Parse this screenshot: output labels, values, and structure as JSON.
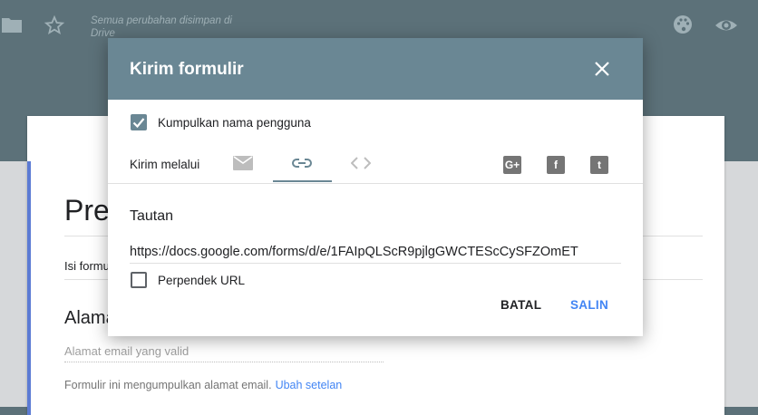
{
  "app": {
    "save_status": "Semua perubahan disimpan di Drive"
  },
  "form": {
    "title": "Pre",
    "description": "Isi formu",
    "question_title": "Alama",
    "question_placeholder": "Alamat email yang valid",
    "note": "Formulir ini mengumpulkan alamat email.",
    "note_link": "Ubah setelan"
  },
  "dialog": {
    "title": "Kirim formulir",
    "collect_email_label": "Kumpulkan nama pengguna",
    "collect_email_checked": true,
    "send_via_label": "Kirim melalui",
    "active_tab": "link",
    "tabs": [
      {
        "id": "email",
        "icon": "email-icon"
      },
      {
        "id": "link",
        "icon": "link-icon"
      },
      {
        "id": "embed",
        "icon": "embed-code-icon"
      }
    ],
    "social": [
      {
        "id": "google-plus",
        "glyph": "G+"
      },
      {
        "id": "facebook",
        "glyph": "f"
      },
      {
        "id": "twitter",
        "glyph": "t"
      }
    ],
    "section_title": "Tautan",
    "link_value": "https://docs.google.com/forms/d/e/1FAIpQLScR9pjlgGWCTEScCySFZOmET",
    "shorten_label": "Perpendek URL",
    "shorten_checked": false,
    "cancel_label": "BATAL",
    "copy_label": "SALIN"
  },
  "colors": {
    "header": "#6a8794",
    "topbar": "#5c7179",
    "accent_link": "#4285f4"
  }
}
